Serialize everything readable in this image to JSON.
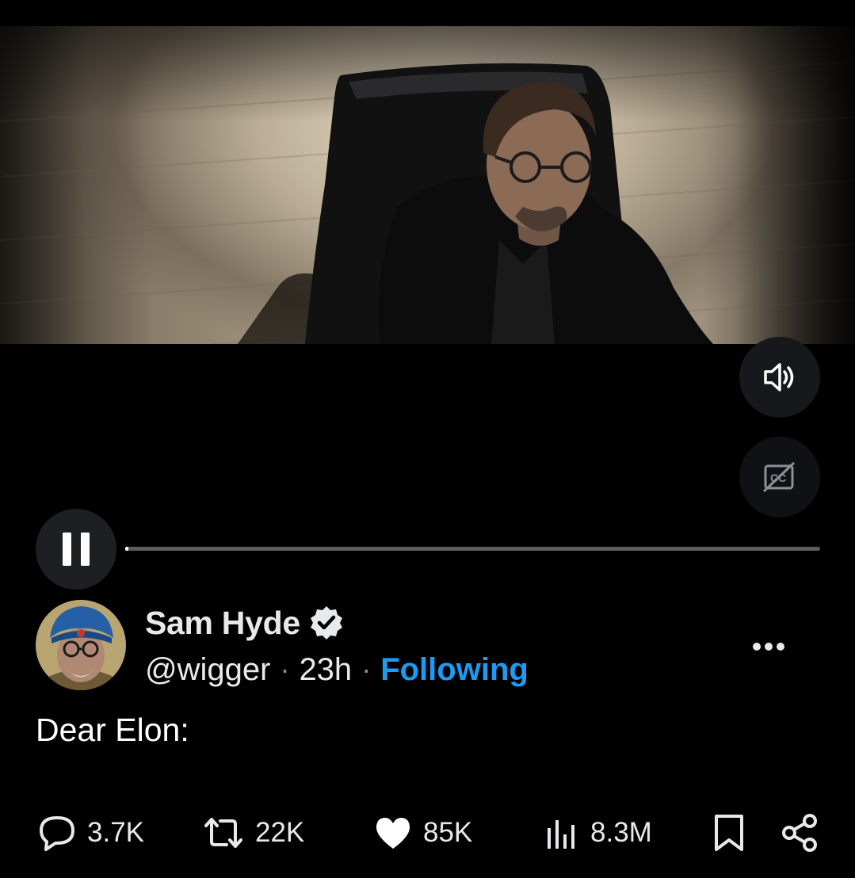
{
  "video": {
    "volume_icon": "volume-icon",
    "captions_icon": "captions-off-icon",
    "pause_icon": "pause-icon",
    "progress": 0.002
  },
  "tweet": {
    "author": {
      "display_name": "Sam Hyde",
      "handle": "@wigger",
      "verified_icon": "verified-badge-icon"
    },
    "separator": "·",
    "time": "23h",
    "follow_status": "Following",
    "more_icon": "more-icon",
    "text": "Dear Elon:"
  },
  "actions": {
    "replies": "3.7K",
    "reposts": "22K",
    "likes": "85K",
    "views": "8.3M",
    "bookmark_icon": "bookmark-icon",
    "share_icon": "share-icon"
  },
  "colors": {
    "background": "#000000",
    "accent": "#1d9bf0",
    "text": "#e7e9ea",
    "muted": "#8b9197"
  }
}
